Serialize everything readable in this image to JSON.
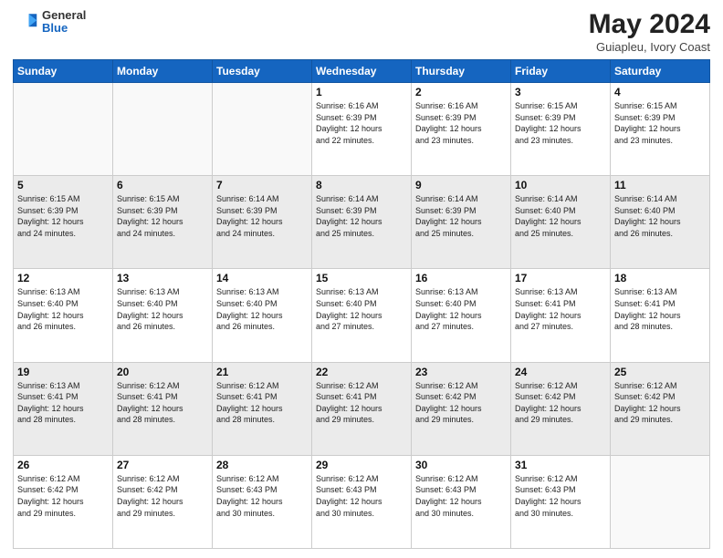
{
  "header": {
    "logo_general": "General",
    "logo_blue": "Blue",
    "title": "May 2024",
    "location": "Guiapleu, Ivory Coast"
  },
  "weekdays": [
    "Sunday",
    "Monday",
    "Tuesday",
    "Wednesday",
    "Thursday",
    "Friday",
    "Saturday"
  ],
  "weeks": [
    [
      {
        "day": "",
        "info": ""
      },
      {
        "day": "",
        "info": ""
      },
      {
        "day": "",
        "info": ""
      },
      {
        "day": "1",
        "info": "Sunrise: 6:16 AM\nSunset: 6:39 PM\nDaylight: 12 hours\nand 22 minutes."
      },
      {
        "day": "2",
        "info": "Sunrise: 6:16 AM\nSunset: 6:39 PM\nDaylight: 12 hours\nand 23 minutes."
      },
      {
        "day": "3",
        "info": "Sunrise: 6:15 AM\nSunset: 6:39 PM\nDaylight: 12 hours\nand 23 minutes."
      },
      {
        "day": "4",
        "info": "Sunrise: 6:15 AM\nSunset: 6:39 PM\nDaylight: 12 hours\nand 23 minutes."
      }
    ],
    [
      {
        "day": "5",
        "info": "Sunrise: 6:15 AM\nSunset: 6:39 PM\nDaylight: 12 hours\nand 24 minutes."
      },
      {
        "day": "6",
        "info": "Sunrise: 6:15 AM\nSunset: 6:39 PM\nDaylight: 12 hours\nand 24 minutes."
      },
      {
        "day": "7",
        "info": "Sunrise: 6:14 AM\nSunset: 6:39 PM\nDaylight: 12 hours\nand 24 minutes."
      },
      {
        "day": "8",
        "info": "Sunrise: 6:14 AM\nSunset: 6:39 PM\nDaylight: 12 hours\nand 25 minutes."
      },
      {
        "day": "9",
        "info": "Sunrise: 6:14 AM\nSunset: 6:39 PM\nDaylight: 12 hours\nand 25 minutes."
      },
      {
        "day": "10",
        "info": "Sunrise: 6:14 AM\nSunset: 6:40 PM\nDaylight: 12 hours\nand 25 minutes."
      },
      {
        "day": "11",
        "info": "Sunrise: 6:14 AM\nSunset: 6:40 PM\nDaylight: 12 hours\nand 26 minutes."
      }
    ],
    [
      {
        "day": "12",
        "info": "Sunrise: 6:13 AM\nSunset: 6:40 PM\nDaylight: 12 hours\nand 26 minutes."
      },
      {
        "day": "13",
        "info": "Sunrise: 6:13 AM\nSunset: 6:40 PM\nDaylight: 12 hours\nand 26 minutes."
      },
      {
        "day": "14",
        "info": "Sunrise: 6:13 AM\nSunset: 6:40 PM\nDaylight: 12 hours\nand 26 minutes."
      },
      {
        "day": "15",
        "info": "Sunrise: 6:13 AM\nSunset: 6:40 PM\nDaylight: 12 hours\nand 27 minutes."
      },
      {
        "day": "16",
        "info": "Sunrise: 6:13 AM\nSunset: 6:40 PM\nDaylight: 12 hours\nand 27 minutes."
      },
      {
        "day": "17",
        "info": "Sunrise: 6:13 AM\nSunset: 6:41 PM\nDaylight: 12 hours\nand 27 minutes."
      },
      {
        "day": "18",
        "info": "Sunrise: 6:13 AM\nSunset: 6:41 PM\nDaylight: 12 hours\nand 28 minutes."
      }
    ],
    [
      {
        "day": "19",
        "info": "Sunrise: 6:13 AM\nSunset: 6:41 PM\nDaylight: 12 hours\nand 28 minutes."
      },
      {
        "day": "20",
        "info": "Sunrise: 6:12 AM\nSunset: 6:41 PM\nDaylight: 12 hours\nand 28 minutes."
      },
      {
        "day": "21",
        "info": "Sunrise: 6:12 AM\nSunset: 6:41 PM\nDaylight: 12 hours\nand 28 minutes."
      },
      {
        "day": "22",
        "info": "Sunrise: 6:12 AM\nSunset: 6:41 PM\nDaylight: 12 hours\nand 29 minutes."
      },
      {
        "day": "23",
        "info": "Sunrise: 6:12 AM\nSunset: 6:42 PM\nDaylight: 12 hours\nand 29 minutes."
      },
      {
        "day": "24",
        "info": "Sunrise: 6:12 AM\nSunset: 6:42 PM\nDaylight: 12 hours\nand 29 minutes."
      },
      {
        "day": "25",
        "info": "Sunrise: 6:12 AM\nSunset: 6:42 PM\nDaylight: 12 hours\nand 29 minutes."
      }
    ],
    [
      {
        "day": "26",
        "info": "Sunrise: 6:12 AM\nSunset: 6:42 PM\nDaylight: 12 hours\nand 29 minutes."
      },
      {
        "day": "27",
        "info": "Sunrise: 6:12 AM\nSunset: 6:42 PM\nDaylight: 12 hours\nand 29 minutes."
      },
      {
        "day": "28",
        "info": "Sunrise: 6:12 AM\nSunset: 6:43 PM\nDaylight: 12 hours\nand 30 minutes."
      },
      {
        "day": "29",
        "info": "Sunrise: 6:12 AM\nSunset: 6:43 PM\nDaylight: 12 hours\nand 30 minutes."
      },
      {
        "day": "30",
        "info": "Sunrise: 6:12 AM\nSunset: 6:43 PM\nDaylight: 12 hours\nand 30 minutes."
      },
      {
        "day": "31",
        "info": "Sunrise: 6:12 AM\nSunset: 6:43 PM\nDaylight: 12 hours\nand 30 minutes."
      },
      {
        "day": "",
        "info": ""
      }
    ]
  ]
}
